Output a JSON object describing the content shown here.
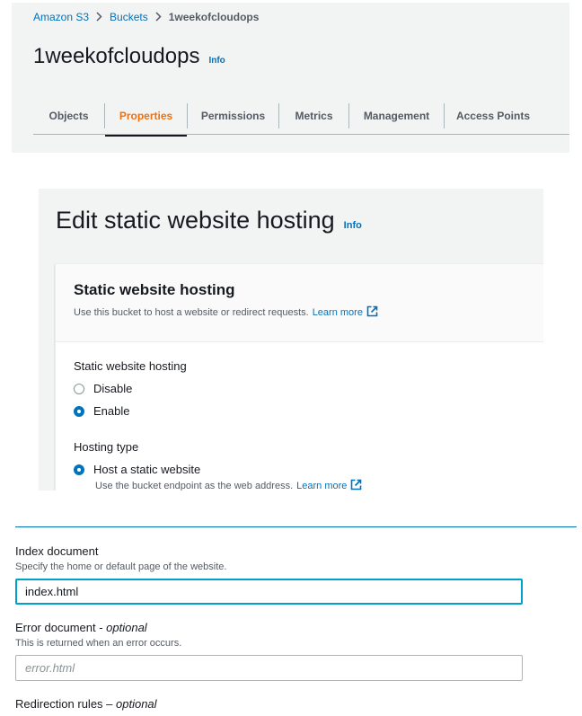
{
  "breadcrumb": {
    "items": [
      "Amazon S3",
      "Buckets",
      "1weekofcloudops"
    ],
    "separator": ">"
  },
  "bucket": {
    "name": "1weekofcloudops",
    "info": "Info"
  },
  "tabs": [
    {
      "label": "Objects",
      "active": false
    },
    {
      "label": "Properties",
      "active": true
    },
    {
      "label": "Permissions",
      "active": false
    },
    {
      "label": "Metrics",
      "active": false
    },
    {
      "label": "Management",
      "active": false
    },
    {
      "label": "Access Points",
      "active": false
    }
  ],
  "edit": {
    "title": "Edit static website hosting",
    "info": "Info",
    "card": {
      "title": "Static website hosting",
      "description": "Use this bucket to host a website or redirect requests.",
      "learn_more": "Learn more"
    },
    "hosting_label": "Static website hosting",
    "hosting_options": [
      {
        "label": "Disable",
        "checked": false
      },
      {
        "label": "Enable",
        "checked": true
      }
    ],
    "hosting_type_label": "Hosting type",
    "hosting_type_option": {
      "label": "Host a static website",
      "checked": true,
      "description": "Use the bucket endpoint as the web address.",
      "learn_more": "Learn more"
    }
  },
  "form": {
    "index_document": {
      "label": "Index document",
      "description": "Specify the home or default page of the website.",
      "value": "index.html"
    },
    "error_document": {
      "label": "Error document - ",
      "optional": "optional",
      "description": "This is returned when an error occurs.",
      "placeholder": "error.html"
    },
    "redirection_rules": {
      "label": "Redirection rules – ",
      "optional": "optional"
    }
  },
  "colors": {
    "link": "#0073bb",
    "active_tab": "#ec7211",
    "focus_border": "#00a1c9",
    "panel_bg": "#f2f3f3"
  },
  "icons": [
    "chevron-right-icon",
    "external-link-icon"
  ]
}
